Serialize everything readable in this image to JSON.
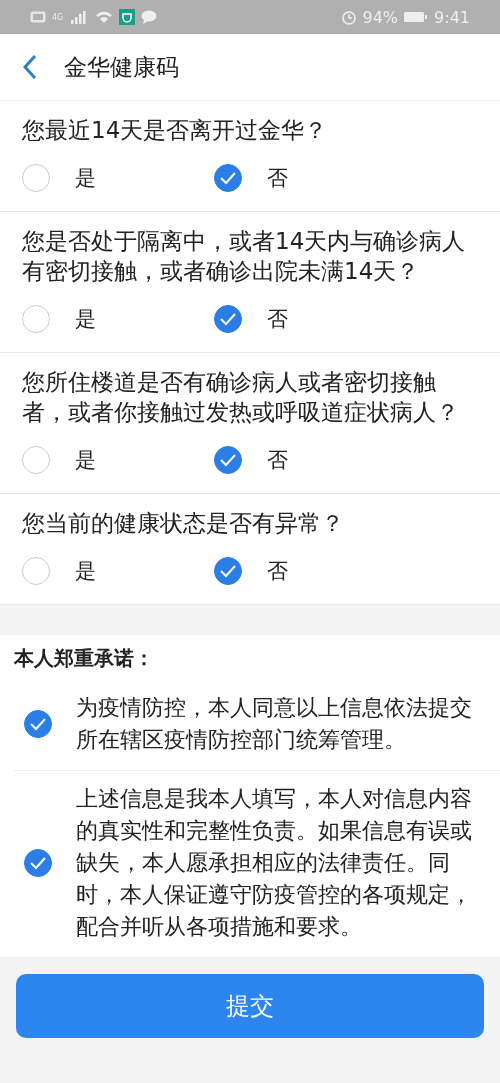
{
  "status_bar": {
    "network": "4G",
    "battery_percent": "94%",
    "time": "9:41"
  },
  "header": {
    "title": "金华健康码"
  },
  "questions": [
    {
      "text": "您最近14天是否离开过金华？",
      "options": [
        {
          "label": "是",
          "selected": false
        },
        {
          "label": "否",
          "selected": true
        }
      ]
    },
    {
      "text": "您是否处于隔离中，或者14天内与确诊病人有密切接触，或者确诊出院未满14天？",
      "options": [
        {
          "label": "是",
          "selected": false
        },
        {
          "label": "否",
          "selected": true
        }
      ]
    },
    {
      "text": "您所住楼道是否有确诊病人或者密切接触者，或者你接触过发热或呼吸道症状病人？",
      "options": [
        {
          "label": "是",
          "selected": false
        },
        {
          "label": "否",
          "selected": true
        }
      ]
    },
    {
      "text": "您当前的健康状态是否有异常？",
      "options": [
        {
          "label": "是",
          "selected": false
        },
        {
          "label": "否",
          "selected": true
        }
      ]
    }
  ],
  "pledge": {
    "title": "本人郑重承诺：",
    "items": [
      {
        "text": "为疫情防控，本人同意以上信息依法提交所在辖区疫情防控部门统筹管理。",
        "checked": true
      },
      {
        "text": "上述信息是我本人填写，本人对信息内容的真实性和完整性负责。如果信息有误或缺失，本人愿承担相应的法律责任。同时，本人保证遵守防疫管控的各项规定，配合并听从各项措施和要求。",
        "checked": true
      }
    ]
  },
  "submit_button": "提交"
}
